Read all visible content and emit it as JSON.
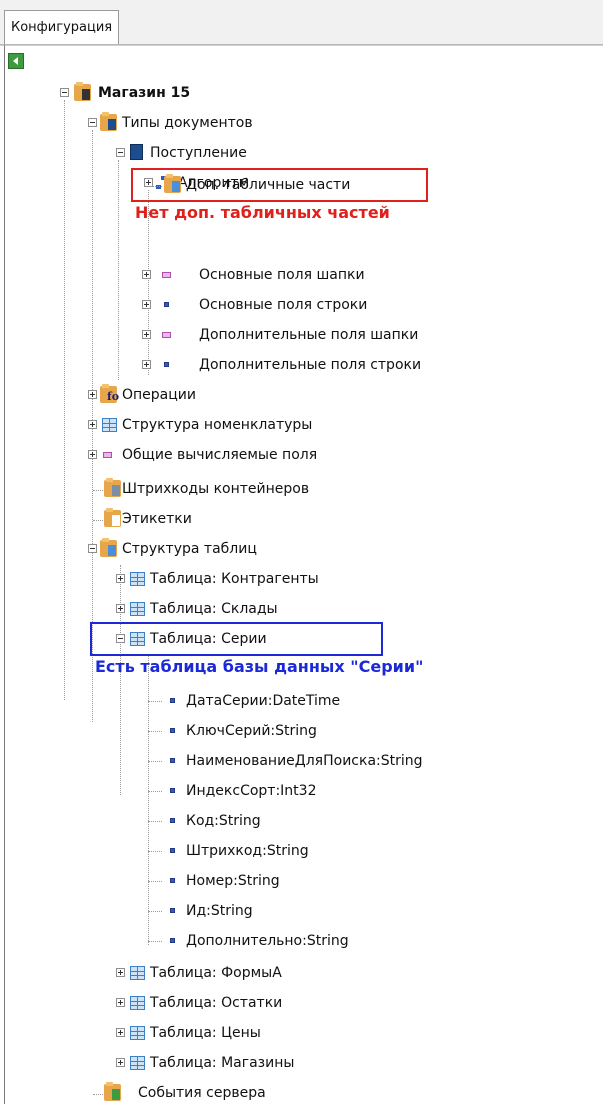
{
  "tab": {
    "label": "Конфигурация"
  },
  "tree": {
    "root": "Магазин 15",
    "doc_types": "Типы документов",
    "receipt": "Поступление",
    "algorithm": "Алгоритм",
    "extra_tables": "Доп. табличные части",
    "head_fields": "Основные поля шапки",
    "row_fields": "Основные поля строки",
    "extra_head_fields": "Дополнительные поля шапки",
    "extra_row_fields": "Дополнительные поля строки",
    "operations": "Операции",
    "nomenclature": "Структура номенклатуры",
    "computed_fields": "Общие вычисляемые поля",
    "container_barcodes": "Штрихкоды контейнеров",
    "labels": "Этикетки",
    "table_structure": "Структура таблиц",
    "t_contragents": "Таблица: Контрагенты",
    "t_warehouses": "Таблица: Склады",
    "t_series": "Таблица: Серии",
    "fields": [
      "ДатаСерии:DateTime",
      "КлючСерий:String",
      "НаименованиеДляПоиска:String",
      "ИндексСорт:Int32",
      "Код:String",
      "Штрихкод:String",
      "Номер:String",
      "Ид:String",
      "Дополнительно:String"
    ],
    "t_forms": "Таблица: ФормыА",
    "t_balances": "Таблица: Остатки",
    "t_prices": "Таблица: Цены",
    "t_shops": "Таблица: Магазины",
    "server_events": "События сервера"
  },
  "annotations": {
    "no_tables": "Нет доп. табличных частей",
    "series_table": "Есть таблица базы данных \"Серии\"",
    "red_color": "#e0201b",
    "blue_color": "#1b29d6"
  }
}
